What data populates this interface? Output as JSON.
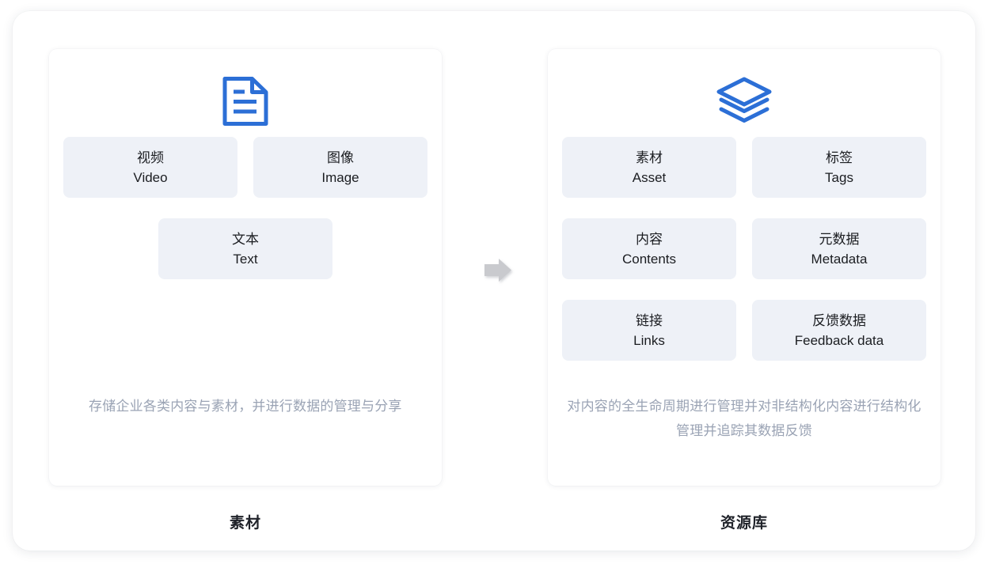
{
  "theme": {
    "icon_blue": "#2c6fd6",
    "chip_bg": "#eef1f7",
    "text_primary": "#1b1d21",
    "text_muted": "#9aa3b4",
    "arrow_gray": "#c9cace",
    "card_bg": "#ffffff"
  },
  "columns": [
    {
      "icon": "document-icon",
      "items": [
        {
          "cn": "视频",
          "en": "Video"
        },
        {
          "cn": "图像",
          "en": "Image"
        },
        {
          "cn": "文本",
          "en": "Text"
        }
      ],
      "description": "存储企业各类内容与素材，并进行数据的管理与分享",
      "caption": "素材"
    },
    {
      "icon": "layers-icon",
      "items": [
        {
          "cn": "素材",
          "en": "Asset"
        },
        {
          "cn": "标签",
          "en": "Tags"
        },
        {
          "cn": "内容",
          "en": "Contents"
        },
        {
          "cn": "元数据",
          "en": "Metadata"
        },
        {
          "cn": "链接",
          "en": "Links"
        },
        {
          "cn": "反馈数据",
          "en": "Feedback data"
        }
      ],
      "description": "对内容的全生命周期进行管理并对非结构化内容进行结构化管理并追踪其数据反馈",
      "caption": "资源库"
    }
  ],
  "connector": {
    "icon": "arrow-right-icon",
    "direction": "right"
  }
}
